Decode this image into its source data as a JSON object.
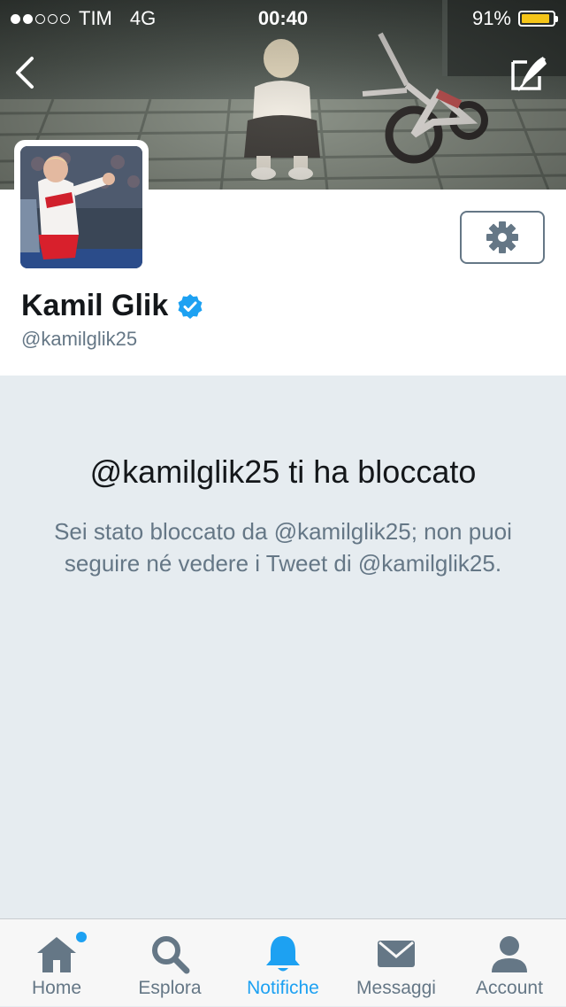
{
  "status_bar": {
    "signal_dots_filled": 2,
    "signal_dots_total": 5,
    "carrier": "TIM",
    "network": "4G",
    "time": "00:40",
    "battery": "91%",
    "battery_level": 0.91
  },
  "header": {
    "back_icon": "chevron-left-icon",
    "compose_icon": "compose-tweet-icon"
  },
  "profile": {
    "name": "Kamil Glik",
    "handle": "@kamilglik25",
    "verified": true,
    "verified_color": "#1da1f2"
  },
  "blocked": {
    "title": "@kamilglik25 ti ha bloccato",
    "description": "Sei stato bloccato da @kamilglik25; non puoi seguire né vedere i Tweet di @kamilglik25."
  },
  "tabbar": {
    "tabs": [
      {
        "label": "Home",
        "icon": "home-icon",
        "active": false,
        "badge": true
      },
      {
        "label": "Esplora",
        "icon": "search-icon",
        "active": false
      },
      {
        "label": "Notifiche",
        "icon": "bell-icon",
        "active": true
      },
      {
        "label": "Messaggi",
        "icon": "envelope-icon",
        "active": false
      },
      {
        "label": "Account",
        "icon": "person-icon",
        "active": false
      }
    ]
  },
  "colors": {
    "accent": "#1da1f2",
    "muted": "#657786",
    "background": "#e6ecf0",
    "battery_fill": "#f5c518"
  }
}
